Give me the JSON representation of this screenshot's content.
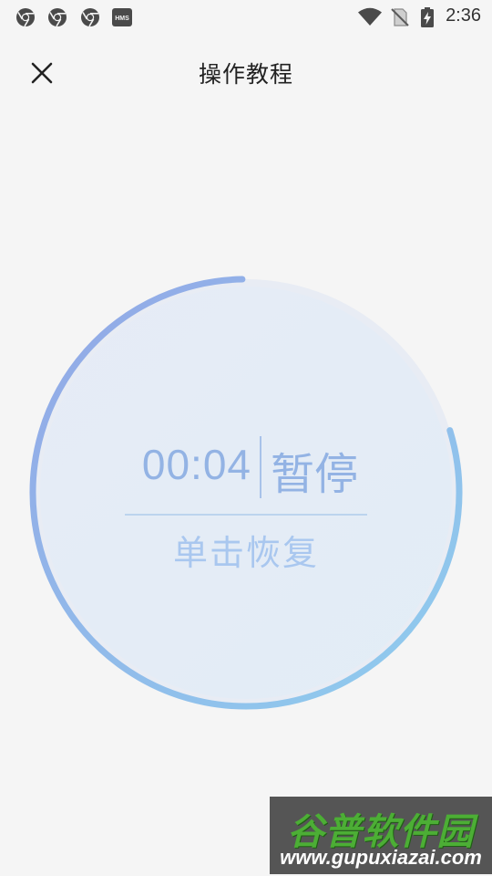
{
  "status_bar": {
    "time": "2:36",
    "left_icons": [
      "chrome-icon",
      "chrome-icon",
      "chrome-icon",
      "hms-icon"
    ],
    "hms_label": "HMS",
    "right_icons": [
      "wifi-icon",
      "no-sim-icon",
      "battery-charging-icon"
    ]
  },
  "header": {
    "title": "操作教程",
    "close_icon": "close-icon"
  },
  "timer": {
    "time": "00:04",
    "state": "暂停",
    "hint": "单击恢复",
    "colors": {
      "start": "#93a7e6",
      "end": "#8fcdee",
      "text": "#93b3e4",
      "track": "#e6ebf3"
    }
  },
  "watermark": {
    "brand": "谷普软件园",
    "url": "www.gupuxiazai.com"
  }
}
